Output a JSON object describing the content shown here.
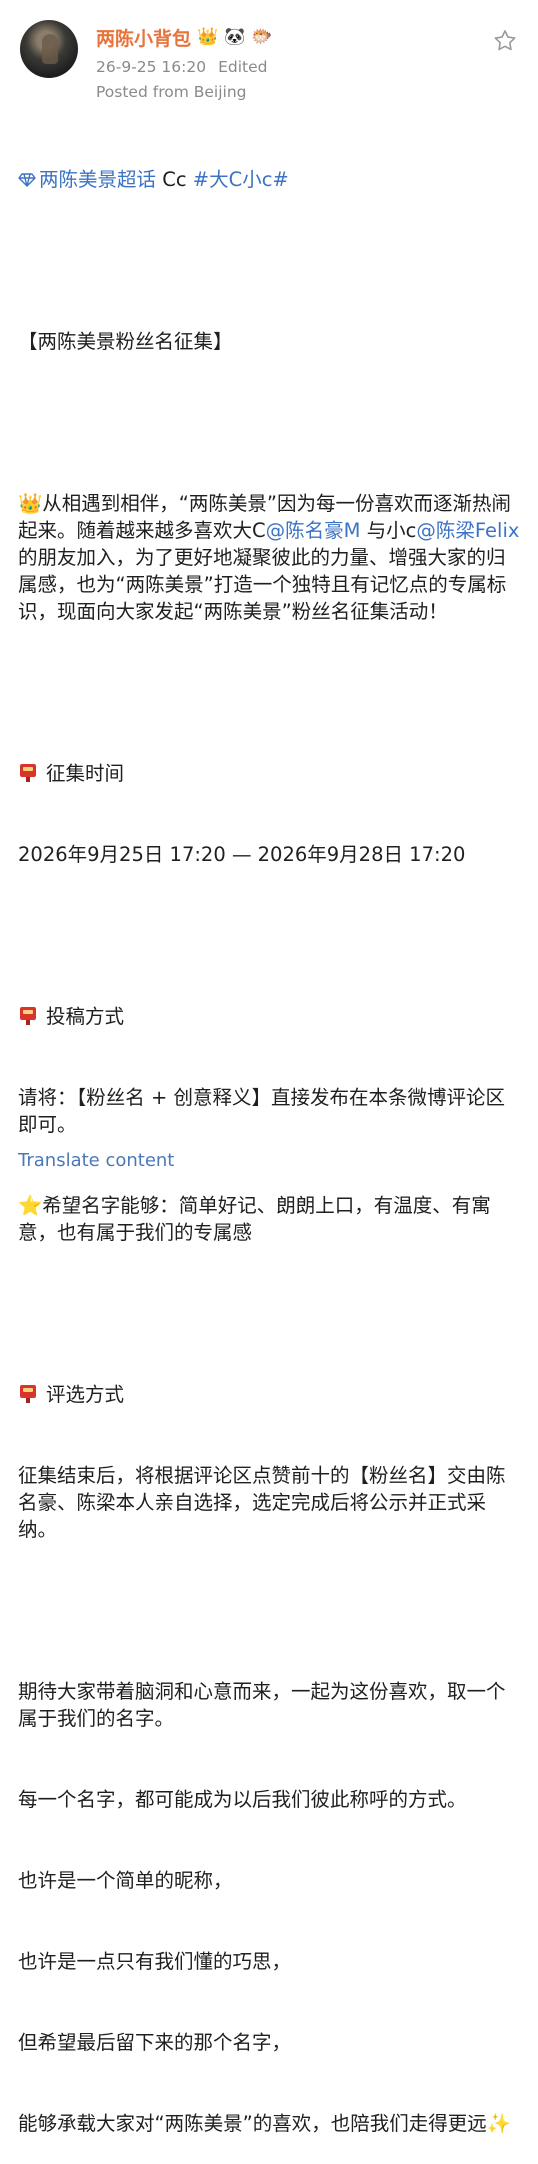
{
  "post": {
    "author": "两陈小背包",
    "badges": [
      "👑",
      "🐼",
      "🐡"
    ],
    "timestamp": "26-9-25 16:20",
    "edited": "Edited",
    "location": "Posted from Beijing",
    "topic_line": {
      "supertopic": "两陈美景超话",
      "text_mid": " Cc ",
      "hashtag": "#大C小c#"
    },
    "title": "【两陈美景粉丝名征集】",
    "intro": {
      "emoji": "👑",
      "part1": "从相遇到相伴，“两陈美景”因为每一份喜欢而逐渐热闹起来。随着越来越多喜欢大C",
      "mention1": "@陈名豪M",
      "part2": " 与小c",
      "mention2": "@陈梁Felix",
      "part3": " 的朋友加入，为了更好地凝聚彼此的力量、增强大家的归属感，也为“两陈美景”打造一个独特且有记忆点的专属标识，现面向大家发起“两陈美景”粉丝名征集活动！"
    },
    "section_time": {
      "heading": "征集时间",
      "body": "2026年9月25日 17:20 — 2026年9月28日 17:20"
    },
    "section_submit": {
      "heading": "投稿方式",
      "body": "请将：【粉丝名 + 创意释义】直接发布在本条微博评论区即可。",
      "star_emoji": "⭐",
      "hope": "希望名字能够：简单好记、朗朗上口，有温度、有寓意，也有属于我们的专属感"
    },
    "section_select": {
      "heading": "评选方式",
      "body": "征集结束后，将根据评论区点赞前十的【粉丝名】交由陈名豪、陈梁本人亲自选择，选定完成后将公示并正式采纳。"
    },
    "closing": {
      "line1": "期待大家带着脑洞和心意而来，一起为这份喜欢，取一个属于我们的名字。",
      "line2": "每一个名字，都可能成为以后我们彼此称呼的方式。",
      "line3": "也许是一个简单的昵称，",
      "line4": "也许是一点只有我们懂的巧思，",
      "line5": "但希望最后留下来的那个名字，",
      "line6": "能够承载大家对“两陈美景”的喜欢，也陪我们走得更远",
      "sparkle": "✨"
    },
    "translate": "Translate content"
  },
  "colors": {
    "username": "#e8743b",
    "link": "#3d73c4",
    "meta": "#8a8a8a",
    "marker": "#d9342b"
  },
  "icons": {
    "favorite": "star-outline-icon",
    "supertopic": "diamond-icon",
    "section_marker": "red-mailbox-icon"
  }
}
